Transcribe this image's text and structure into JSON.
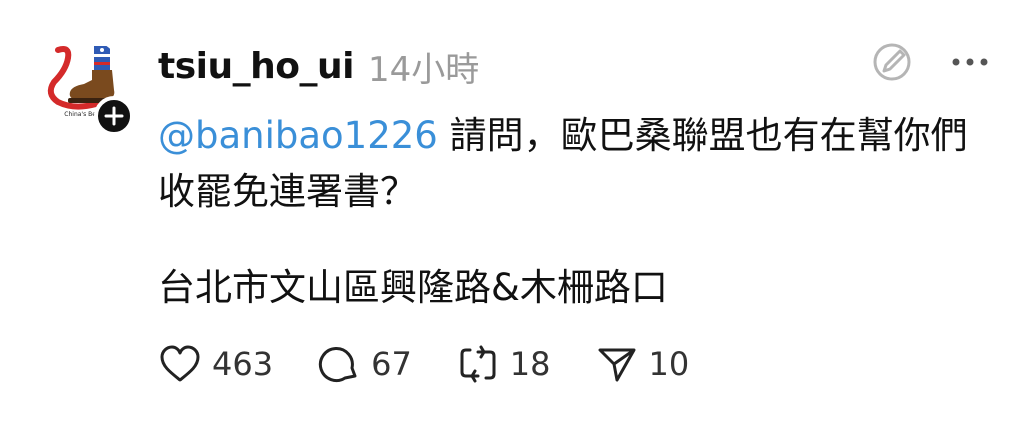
{
  "post": {
    "author": {
      "username": "tsiu_ho_ui",
      "timestamp": "14小時"
    },
    "content": {
      "mention": "@banibao1226",
      "line1_rest": " 請問，歐巴桑聯盟也有在幫你們",
      "line2": "收罷免連署書？",
      "line3": "台北市文山區興隆路&木柵路口"
    },
    "stats": {
      "likes": "463",
      "comments": "67",
      "reposts": "18",
      "shares": "10"
    },
    "icons": {
      "avatar": "boot-avatar",
      "follow": "plus-icon",
      "edit": "edit-icon",
      "more": "more-icon",
      "like": "heart-icon",
      "comment": "comment-icon",
      "repost": "repost-icon",
      "share": "send-icon"
    },
    "colors": {
      "mention": "#3a8fd8",
      "timestamp": "#9a9a9a",
      "text": "#111111"
    }
  }
}
